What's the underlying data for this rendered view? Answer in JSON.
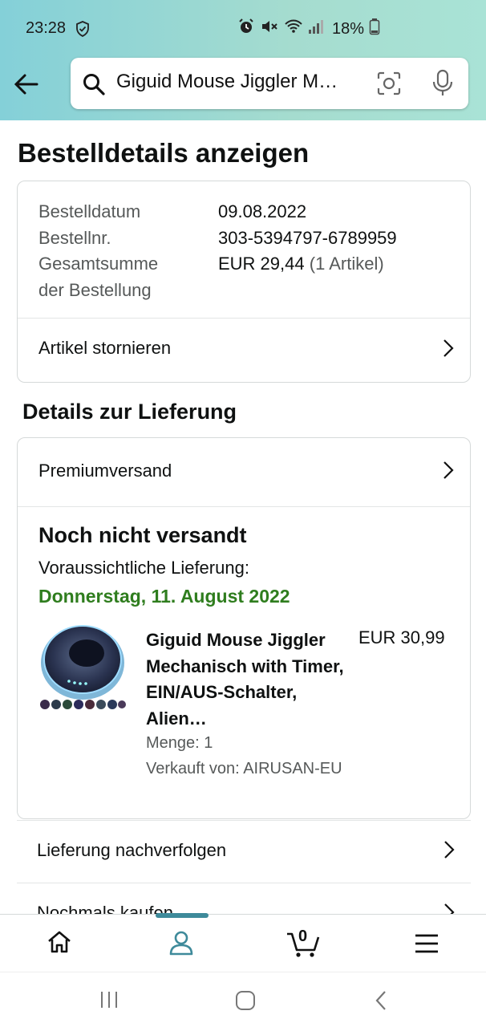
{
  "status_bar": {
    "time": "23:28",
    "battery": "18%"
  },
  "search": {
    "query": "Giguid Mouse Jiggler M…"
  },
  "page": {
    "title": "Bestelldetails anzeigen"
  },
  "order_summary": {
    "rows": [
      {
        "label": "Bestelldatum",
        "value": "09.08.2022"
      },
      {
        "label": "Bestellnr.",
        "value": "303-5394797-6789959"
      },
      {
        "label": "Gesamtsumme",
        "value": "EUR 29,44"
      },
      {
        "label": "der Bestellung",
        "value": ""
      }
    ],
    "items_count": "(1 Artikel)",
    "cancel_label": "Artikel stornieren"
  },
  "delivery": {
    "section_title": "Details zur Lieferung",
    "shipping_method": "Premiumversand",
    "status": "Noch nicht versandt",
    "expected_label": "Voraussichtliche Lieferung:",
    "expected_date": "Donnerstag, 11. August 2022",
    "expected_date_color": "#2f7d1e",
    "product": {
      "title": "Giguid Mouse Jiggler Mechanisch with Timer, EIN/AUS-Schalter, Alien…",
      "price": "EUR 30,99",
      "quantity": "Menge: 1",
      "seller": "Verkauft von: AIRUSAN-EU"
    }
  },
  "actions": {
    "track": "Lieferung nachverfolgen",
    "buy_again": "Nochmals kaufen"
  },
  "bottom_nav": {
    "items": [
      "home-icon",
      "account-icon",
      "cart-icon",
      "menu-icon"
    ],
    "cart_count": "0",
    "accent_color": "#3e8a9a"
  }
}
